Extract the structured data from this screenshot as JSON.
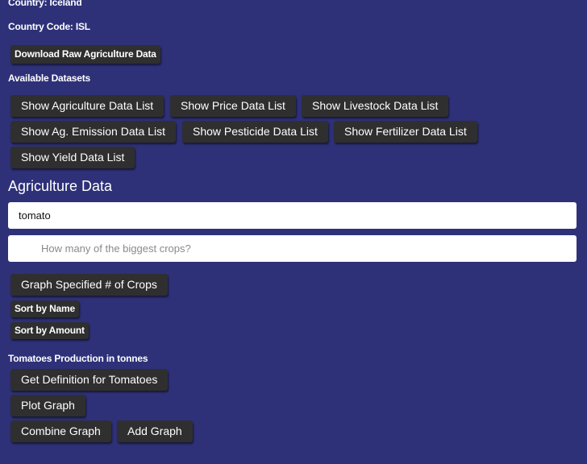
{
  "info": {
    "country": "Country: Iceland",
    "country_code": "Country Code: ISL"
  },
  "download_button": "Download Raw Agriculture Data",
  "datasets": {
    "heading": "Available Datasets",
    "buttons": [
      "Show Agriculture Data List",
      "Show Price Data List",
      "Show Livestock Data List",
      "Show Ag. Emission Data List",
      "Show Pesticide Data List",
      "Show Fertilizer Data List",
      "Show Yield Data List"
    ]
  },
  "agriculture": {
    "heading": "Agriculture Data",
    "search_value": "tomato",
    "count_placeholder": "How many of the biggest crops?",
    "graph_button": "Graph Specified # of Crops",
    "sort_name": "Sort by Name",
    "sort_amount": "Sort by Amount"
  },
  "production": {
    "heading": "Tomatoes Production in tonnes",
    "definition_button": "Get Definition for Tomatoes",
    "plot_button": "Plot Graph",
    "combine_button": "Combine Graph",
    "add_button": "Add Graph"
  }
}
